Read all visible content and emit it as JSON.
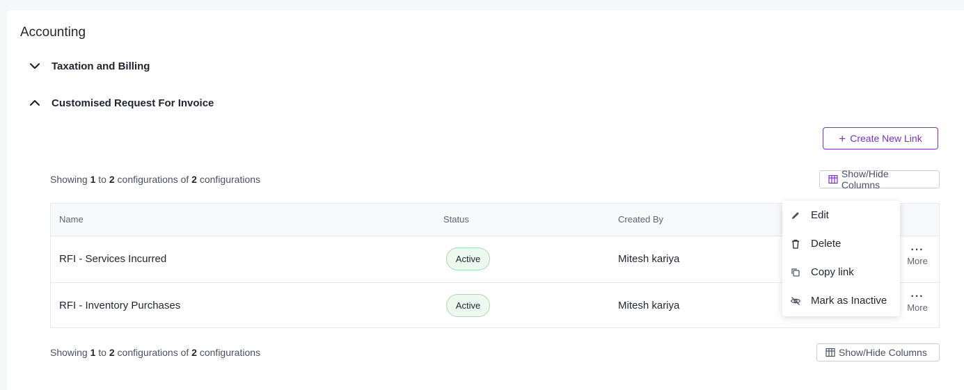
{
  "page": {
    "title": "Accounting"
  },
  "sections": [
    {
      "label": "Taxation and Billing",
      "expanded": false
    },
    {
      "label": "Customised Request For Invoice",
      "expanded": true
    }
  ],
  "create_button": {
    "label": "Create New Link",
    "icon": "plus-icon"
  },
  "showing": {
    "prefix": "Showing",
    "from": "1",
    "to_word": "to",
    "to": "2",
    "of_word": "configurations of",
    "total": "2",
    "suffix": "configurations"
  },
  "columns_button": {
    "label": "Show/Hide Columns",
    "icon": "table-columns-icon"
  },
  "table": {
    "headers": {
      "name": "Name",
      "status": "Status",
      "created_by": "Created By"
    },
    "rows": [
      {
        "name": "RFI - Services Incurred",
        "status": "Active",
        "created_by": "Mitesh kariya",
        "more": "More"
      },
      {
        "name": "RFI - Inventory Purchases",
        "status": "Active",
        "created_by": "Mitesh kariya",
        "more": "More"
      }
    ]
  },
  "context_menu": {
    "items": [
      {
        "label": "Edit",
        "icon": "pencil-icon"
      },
      {
        "label": "Delete",
        "icon": "trash-icon"
      },
      {
        "label": "Copy link",
        "icon": "copy-icon"
      },
      {
        "label": "Mark as Inactive",
        "icon": "eye-off-icon"
      }
    ]
  },
  "colors": {
    "accent": "#7b2fc9",
    "badge_bg": "#edf8ef",
    "badge_border": "#a9d8b4"
  }
}
